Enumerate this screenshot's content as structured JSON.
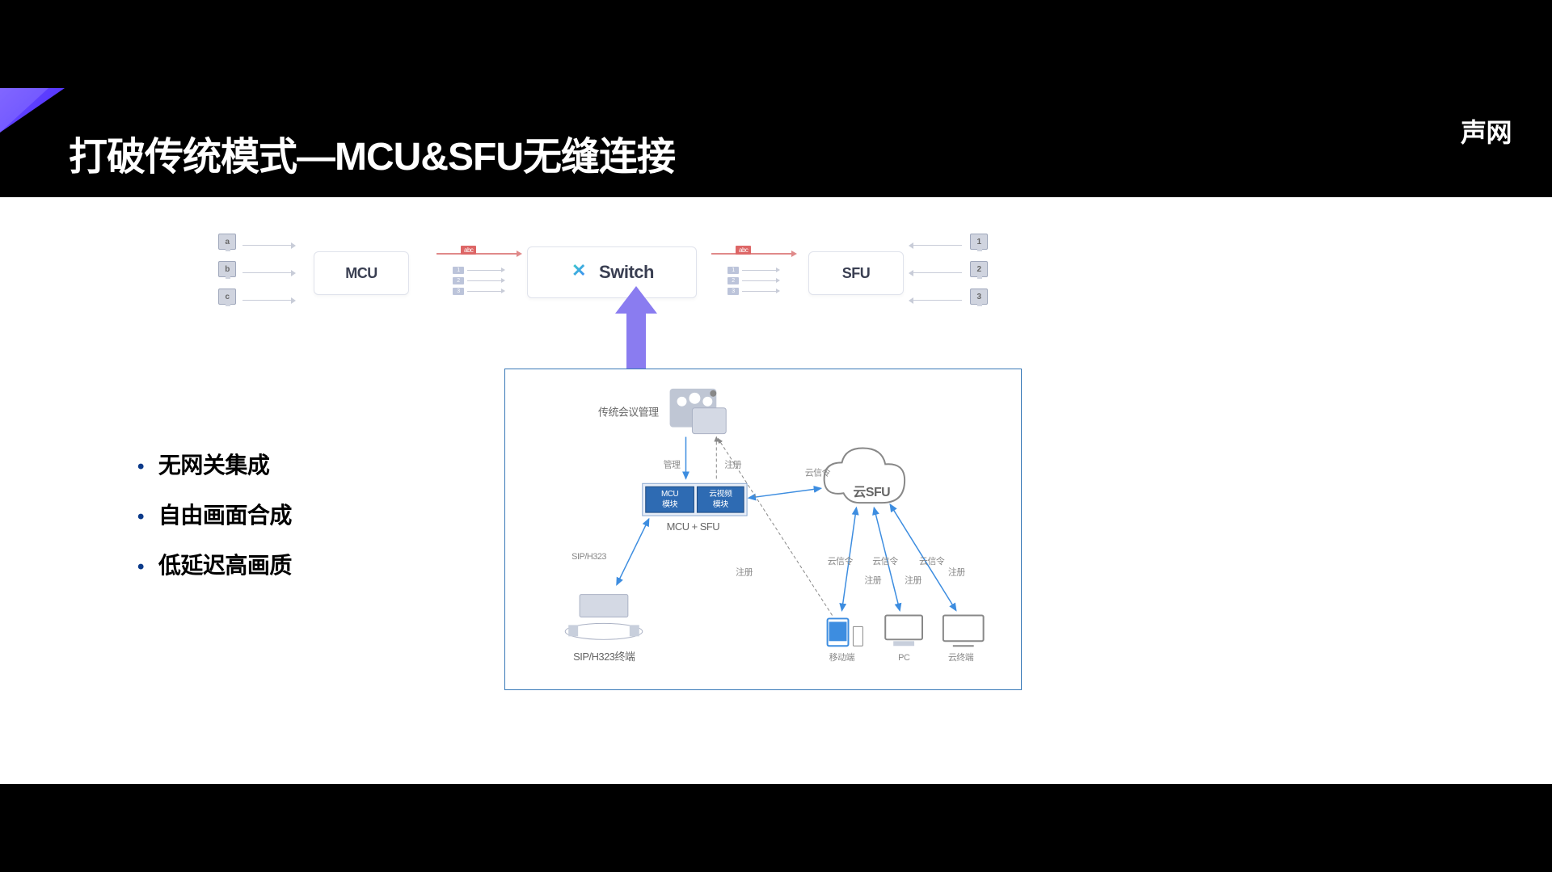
{
  "header": {
    "title": "打破传统模式—MCU&SFU无缝连接",
    "brand": "声网"
  },
  "flow": {
    "left_endpoints": [
      "a",
      "b",
      "c"
    ],
    "right_endpoints": [
      "1",
      "2",
      "3"
    ],
    "mcu": "MCU",
    "switch": "Switch",
    "sfu": "SFU",
    "combined_chip": "abc",
    "stream_labels": [
      "1",
      "2",
      "3"
    ]
  },
  "bullets": [
    "无网关集成",
    "自由画面合成",
    "低延迟高画质"
  ],
  "panel": {
    "conf_mgmt": "传统会议管理",
    "manage": "管理",
    "register": "注册",
    "mcu_module": "MCU",
    "mcu_module2": "模块",
    "cloud_video": "云视频",
    "cloud_video2": "模块",
    "mcu_sfu": "MCU + SFU",
    "sip": "SIP/H323",
    "sip_terminal": "SIP/H323终端",
    "cloud_signal": "云信令",
    "cloud_sfu": "云SFU",
    "mobile": "移动端",
    "pc": "PC",
    "cloud_terminal": "云终端"
  }
}
